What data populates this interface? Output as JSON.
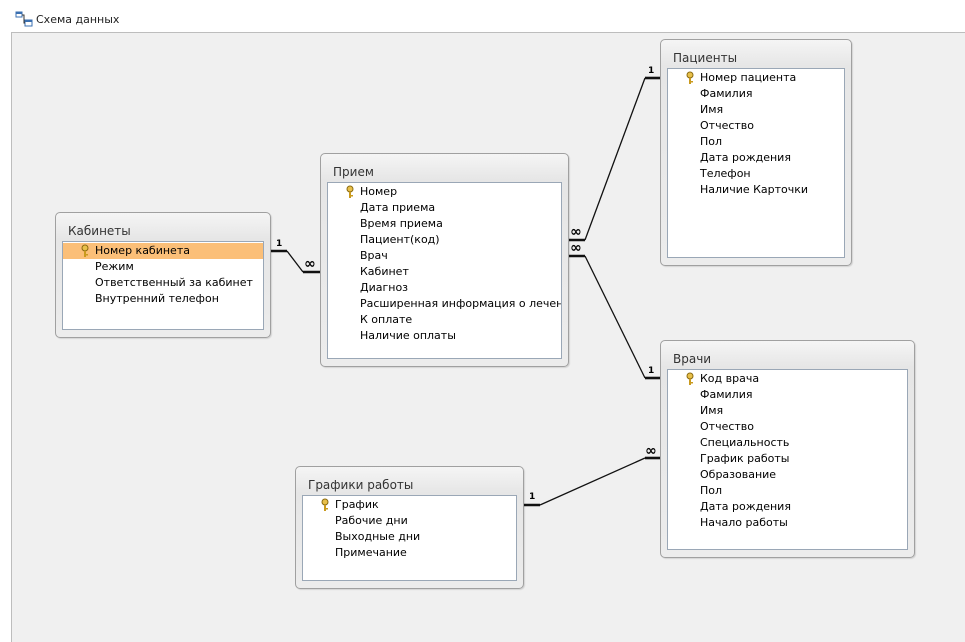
{
  "window": {
    "title": "Схема данных",
    "icon": "relationships-icon"
  },
  "tables": {
    "kabinety": {
      "title": "Кабинеты",
      "fields": [
        "Номер кабинета",
        "Режим",
        "Ответственный за кабинет",
        "Внутренний телефон"
      ]
    },
    "priem": {
      "title": "Прием",
      "fields": [
        "Номер",
        "Дата приема",
        "Время приема",
        "Пациент(код)",
        "Врач",
        "Кабинет",
        "Диагноз",
        "Расширенная информация о лечении",
        "К оплате",
        "Наличие оплаты"
      ]
    },
    "patsienty": {
      "title": "Пациенты",
      "fields": [
        "Номер пациента",
        "Фамилия",
        "Имя",
        "Отчество",
        "Пол",
        "Дата рождения",
        "Телефон",
        "Наличие Карточки"
      ]
    },
    "vrachi": {
      "title": "Врачи",
      "fields": [
        "Код врача",
        "Фамилия",
        "Имя",
        "Отчество",
        "Специальность",
        "График работы",
        "Образование",
        "Пол",
        "Дата рождения",
        "Начало работы"
      ]
    },
    "grafiki": {
      "title": "Графики работы",
      "fields": [
        "График",
        "Рабочие дни",
        "Выходные дни",
        "Примечание"
      ]
    }
  },
  "relationships": {
    "one": "1",
    "many": "∞"
  }
}
